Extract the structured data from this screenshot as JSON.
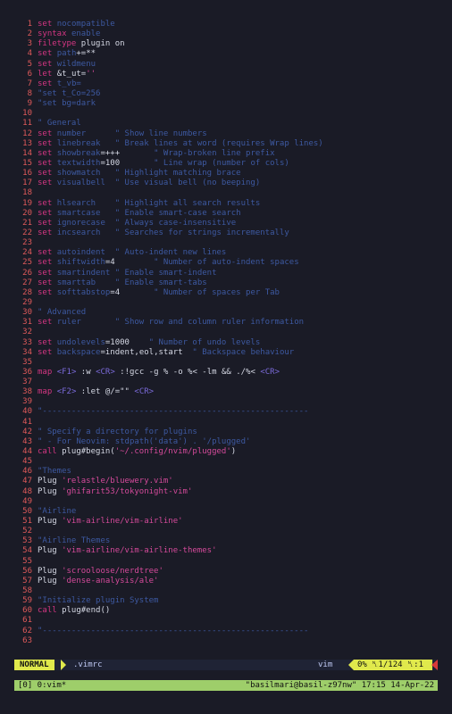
{
  "editor": {
    "lines": [
      {
        "n": "1",
        "segs": [
          [
            "kw",
            "set "
          ],
          [
            "com",
            "nocompatible"
          ]
        ]
      },
      {
        "n": "2",
        "segs": [
          [
            "kw",
            "syntax "
          ],
          [
            "com",
            "enable"
          ]
        ]
      },
      {
        "n": "3",
        "segs": [
          [
            "kw",
            "filetype "
          ],
          [
            "txt",
            "plugin on"
          ]
        ]
      },
      {
        "n": "4",
        "segs": [
          [
            "kw",
            "set "
          ],
          [
            "com",
            "path"
          ],
          [
            "txt",
            "+=**"
          ]
        ]
      },
      {
        "n": "5",
        "segs": [
          [
            "kw",
            "set "
          ],
          [
            "com",
            "wildmenu"
          ]
        ]
      },
      {
        "n": "6",
        "segs": [
          [
            "kw",
            "let "
          ],
          [
            "txt",
            "&t_ut="
          ],
          [
            "str",
            "''"
          ]
        ]
      },
      {
        "n": "7",
        "segs": [
          [
            "kw",
            "set "
          ],
          [
            "com",
            "t_vb="
          ]
        ]
      },
      {
        "n": "8",
        "segs": [
          [
            "com",
            "\"set t_Co=256"
          ]
        ]
      },
      {
        "n": "9",
        "segs": [
          [
            "com",
            "\"set bg=dark"
          ]
        ]
      },
      {
        "n": "10",
        "segs": []
      },
      {
        "n": "11",
        "segs": [
          [
            "com",
            "\" General"
          ]
        ]
      },
      {
        "n": "12",
        "segs": [
          [
            "kw",
            "set "
          ],
          [
            "com",
            "number      \" Show line numbers"
          ]
        ]
      },
      {
        "n": "13",
        "segs": [
          [
            "kw",
            "set "
          ],
          [
            "com",
            "linebreak   \" Break lines at word (requires Wrap lines)"
          ]
        ]
      },
      {
        "n": "14",
        "segs": [
          [
            "kw",
            "set "
          ],
          [
            "com",
            "showbreak"
          ],
          [
            "txt",
            "=+++"
          ],
          [
            "com",
            "       \" Wrap-broken line prefix"
          ]
        ]
      },
      {
        "n": "15",
        "segs": [
          [
            "kw",
            "set "
          ],
          [
            "com",
            "textwidth"
          ],
          [
            "txt",
            "=100"
          ],
          [
            "com",
            "       \" Line wrap (number of cols)"
          ]
        ]
      },
      {
        "n": "16",
        "segs": [
          [
            "kw",
            "set "
          ],
          [
            "com",
            "showmatch   \" Highlight matching brace"
          ]
        ]
      },
      {
        "n": "17",
        "segs": [
          [
            "kw",
            "set "
          ],
          [
            "com",
            "visualbell  \" Use visual bell (no beeping)"
          ]
        ]
      },
      {
        "n": "18",
        "segs": []
      },
      {
        "n": "19",
        "segs": [
          [
            "kw",
            "set "
          ],
          [
            "com",
            "hlsearch    \" Highlight all search results"
          ]
        ]
      },
      {
        "n": "20",
        "segs": [
          [
            "kw",
            "set "
          ],
          [
            "com",
            "smartcase   \" Enable smart-case search"
          ]
        ]
      },
      {
        "n": "21",
        "segs": [
          [
            "kw",
            "set "
          ],
          [
            "com",
            "ignorecase  \" Always case-insensitive"
          ]
        ]
      },
      {
        "n": "22",
        "segs": [
          [
            "kw",
            "set "
          ],
          [
            "com",
            "incsearch   \" Searches for strings incrementally"
          ]
        ]
      },
      {
        "n": "23",
        "segs": []
      },
      {
        "n": "24",
        "segs": [
          [
            "kw",
            "set "
          ],
          [
            "com",
            "autoindent  \" Auto-indent new lines"
          ]
        ]
      },
      {
        "n": "25",
        "segs": [
          [
            "kw",
            "set "
          ],
          [
            "com",
            "shiftwidth"
          ],
          [
            "txt",
            "=4"
          ],
          [
            "com",
            "        \" Number of auto-indent spaces"
          ]
        ]
      },
      {
        "n": "26",
        "segs": [
          [
            "kw",
            "set "
          ],
          [
            "com",
            "smartindent \" Enable smart-indent"
          ]
        ]
      },
      {
        "n": "27",
        "segs": [
          [
            "kw",
            "set "
          ],
          [
            "com",
            "smarttab    \" Enable smart-tabs"
          ]
        ]
      },
      {
        "n": "28",
        "segs": [
          [
            "kw",
            "set "
          ],
          [
            "com",
            "softtabstop"
          ],
          [
            "txt",
            "=4"
          ],
          [
            "com",
            "       \" Number of spaces per Tab"
          ]
        ]
      },
      {
        "n": "29",
        "segs": []
      },
      {
        "n": "30",
        "segs": [
          [
            "com",
            "\" Advanced"
          ]
        ]
      },
      {
        "n": "31",
        "segs": [
          [
            "kw",
            "set "
          ],
          [
            "com",
            "ruler       \" Show row and column ruler information"
          ]
        ]
      },
      {
        "n": "32",
        "segs": []
      },
      {
        "n": "33",
        "segs": [
          [
            "kw",
            "set "
          ],
          [
            "com",
            "undolevels"
          ],
          [
            "txt",
            "=1000"
          ],
          [
            "com",
            "    \" Number of undo levels"
          ]
        ]
      },
      {
        "n": "34",
        "segs": [
          [
            "kw",
            "set "
          ],
          [
            "com",
            "backspace"
          ],
          [
            "txt",
            "=indent,eol,start"
          ],
          [
            "com",
            "  \" Backspace behaviour"
          ]
        ]
      },
      {
        "n": "35",
        "segs": []
      },
      {
        "n": "36",
        "segs": [
          [
            "kw",
            "map "
          ],
          [
            "key",
            "<F1>"
          ],
          [
            "txt",
            " :w "
          ],
          [
            "key",
            "<CR>"
          ],
          [
            "txt",
            " :!gcc -g % -o %< -lm && ./%< "
          ],
          [
            "key",
            "<CR>"
          ]
        ]
      },
      {
        "n": "37",
        "segs": []
      },
      {
        "n": "38",
        "segs": [
          [
            "kw",
            "map "
          ],
          [
            "key",
            "<F2>"
          ],
          [
            "txt",
            " :let @/=\"\" "
          ],
          [
            "key",
            "<CR>"
          ]
        ]
      },
      {
        "n": "39",
        "segs": []
      },
      {
        "n": "40",
        "segs": [
          [
            "com",
            "\"-------------------------------------------------------"
          ]
        ]
      },
      {
        "n": "41",
        "segs": []
      },
      {
        "n": "42",
        "segs": [
          [
            "com",
            "\" Specify a directory for plugins"
          ]
        ]
      },
      {
        "n": "43",
        "segs": [
          [
            "com",
            "\" - For Neovim: stdpath('data') . '/plugged'"
          ]
        ]
      },
      {
        "n": "44",
        "segs": [
          [
            "kw",
            "call "
          ],
          [
            "txt",
            "plug#begin("
          ],
          [
            "str",
            "'~/.config/nvim/plugged'"
          ],
          [
            "txt",
            ")"
          ]
        ]
      },
      {
        "n": "45",
        "segs": []
      },
      {
        "n": "46",
        "segs": [
          [
            "com",
            "\"Themes"
          ]
        ]
      },
      {
        "n": "47",
        "segs": [
          [
            "txt",
            "Plug "
          ],
          [
            "str",
            "'relastle/bluewery.vim'"
          ]
        ]
      },
      {
        "n": "48",
        "segs": [
          [
            "txt",
            "Plug "
          ],
          [
            "str",
            "'ghifarit53/tokyonight-vim'"
          ]
        ]
      },
      {
        "n": "49",
        "segs": []
      },
      {
        "n": "50",
        "segs": [
          [
            "com",
            "\"Airline"
          ]
        ]
      },
      {
        "n": "51",
        "segs": [
          [
            "txt",
            "Plug "
          ],
          [
            "str",
            "'vim-airline/vim-airline'"
          ]
        ]
      },
      {
        "n": "52",
        "segs": []
      },
      {
        "n": "53",
        "segs": [
          [
            "com",
            "\"Airline Themes"
          ]
        ]
      },
      {
        "n": "54",
        "segs": [
          [
            "txt",
            "Plug "
          ],
          [
            "str",
            "'vim-airline/vim-airline-themes'"
          ]
        ]
      },
      {
        "n": "55",
        "segs": []
      },
      {
        "n": "56",
        "segs": [
          [
            "txt",
            "Plug "
          ],
          [
            "str",
            "'scrooloose/nerdtree'"
          ]
        ]
      },
      {
        "n": "57",
        "segs": [
          [
            "txt",
            "Plug "
          ],
          [
            "str",
            "'dense-analysis/ale'"
          ]
        ]
      },
      {
        "n": "58",
        "segs": []
      },
      {
        "n": "59",
        "segs": [
          [
            "com",
            "\"Initialize plugin System"
          ]
        ]
      },
      {
        "n": "60",
        "segs": [
          [
            "kw",
            "call "
          ],
          [
            "txt",
            "plug#end()"
          ]
        ]
      },
      {
        "n": "61",
        "segs": []
      },
      {
        "n": "62",
        "segs": [
          [
            "com",
            "\"-------------------------------------------------------"
          ]
        ]
      },
      {
        "n": "63",
        "segs": []
      }
    ]
  },
  "statusline": {
    "mode": "NORMAL",
    "filename": ".vimrc",
    "filetype": "vim",
    "position": "0% ␤1/124 ␤:1"
  },
  "tmux": {
    "window": "[0] 0:vim*",
    "host_info": "\"basilmari@basil-z97nw\" 17:15 14-Apr-22"
  },
  "colors": {
    "background": "#1a1b26",
    "line_number": "#e05a5a",
    "keyword": "#d33682",
    "comment": "#3d59a1",
    "string": "#d44a9a",
    "mode_bg": "#e0e94c",
    "tmux_bg": "#9ece6a",
    "warning": "#d83a3a"
  }
}
